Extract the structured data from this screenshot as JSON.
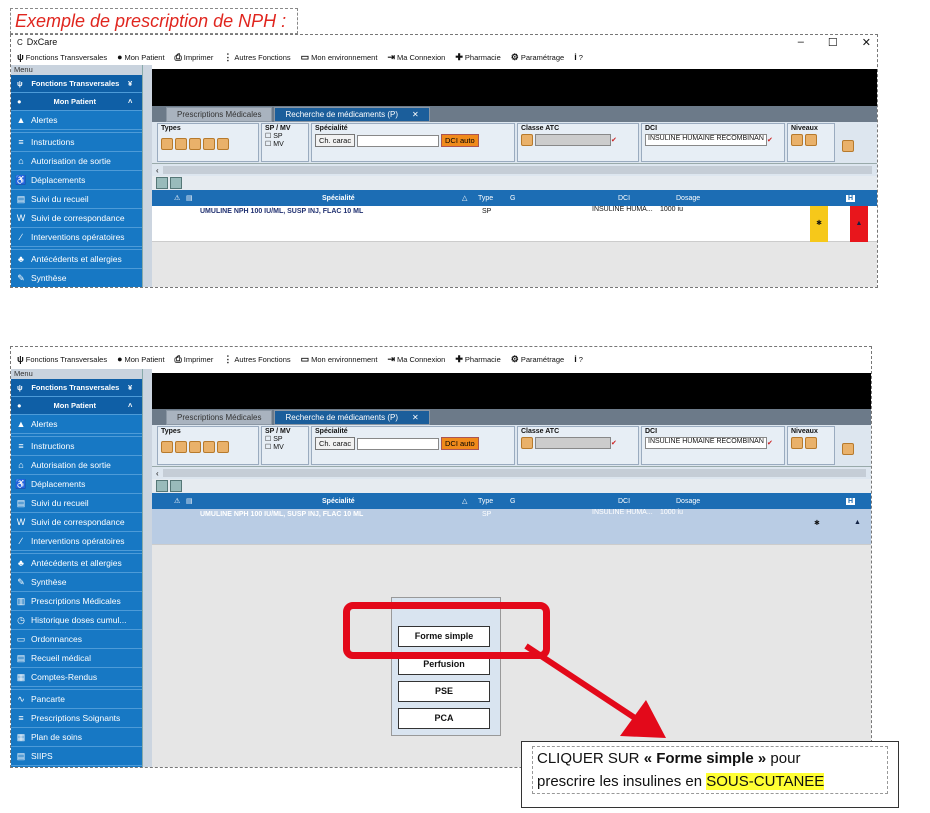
{
  "heading": "Exemple de prescription de NPH :",
  "window": {
    "app_title": "DxCare",
    "controls": [
      "–",
      "☐",
      "✕"
    ]
  },
  "menu_bar": [
    {
      "icon": "tree-icon",
      "label": "Fonctions Transversales"
    },
    {
      "icon": "person-icon",
      "label": "Mon Patient"
    },
    {
      "icon": "printer-icon",
      "label": "Imprimer"
    },
    {
      "icon": "dots-icon",
      "label": "Autres Fonctions"
    },
    {
      "icon": "monitor-icon",
      "label": "Mon environnement"
    },
    {
      "icon": "login-icon",
      "label": "Ma Connexion"
    },
    {
      "icon": "cross-icon",
      "label": "Pharmacie"
    },
    {
      "icon": "gear-icon",
      "label": "Paramétrage"
    },
    {
      "icon": "info-icon",
      "label": "?"
    }
  ],
  "sidebar": {
    "menu_label": "Menu",
    "section1": "Fonctions Transversales",
    "section2": "Mon Patient",
    "section_chevron1": "¥",
    "section_chevron2": "˄",
    "items_top": [
      "Alertes",
      "Instructions",
      "Autorisation de sortie",
      "Déplacements",
      "Suivi du recueil",
      "Suivi de correspondance",
      "Interventions opératoires",
      "Antécédents et allergies",
      "Synthèse"
    ],
    "items_bottom_extra": [
      "Prescriptions Médicales",
      "Historique doses cumul...",
      "Ordonnances",
      "Recueil médical",
      "Comptes-Rendus",
      "Pancarte",
      "Prescriptions Soignants",
      "Plan de soins",
      "SIIPS"
    ]
  },
  "tabs": {
    "inactive": "Prescriptions Médicales",
    "active": "Recherche de médicaments (P)",
    "close": "✕"
  },
  "filters": {
    "types_label": "Types",
    "spmv_label": "SP / MV",
    "sp": "SP",
    "mv": "MV",
    "specialite_label": "Spécialité",
    "ch_carac": "Ch. carac",
    "dci_auto": "DCI auto",
    "classe_atc_label": "Classe ATC",
    "dci_label": "DCI",
    "dci_value": "INSULINE HUMAINE RECOMBINAN",
    "niveaux_label": "Niveaux"
  },
  "grid": {
    "headers": {
      "specialite": "Spécialité",
      "type": "Type",
      "g": "G",
      "dci": "DCI",
      "dosage": "Dosage",
      "h": "H"
    },
    "sort_indicator": "△",
    "row": {
      "name": "UMULINE NPH 100 IU/ML, SUSP INJ, FLAC 10 ML",
      "type": "SP",
      "dci": "INSULINE HUMA...",
      "dosage": "1000 iu"
    }
  },
  "popup": {
    "options": [
      "Forme simple",
      "Perfusion",
      "PSE",
      "PCA"
    ]
  },
  "callout": {
    "part1": "CLIQUER SUR ",
    "quote_open": "« ",
    "bold": "Forme simple",
    "quote_close": " »",
    "part2": " pour",
    "part3": "prescrire les insulines en ",
    "highlight": "SOUS-CUTANEE"
  },
  "colors": {
    "accent_blue": "#1778c4",
    "red": "#e3091a",
    "orange": "#f08a1b",
    "highlight": "#ffff33"
  }
}
